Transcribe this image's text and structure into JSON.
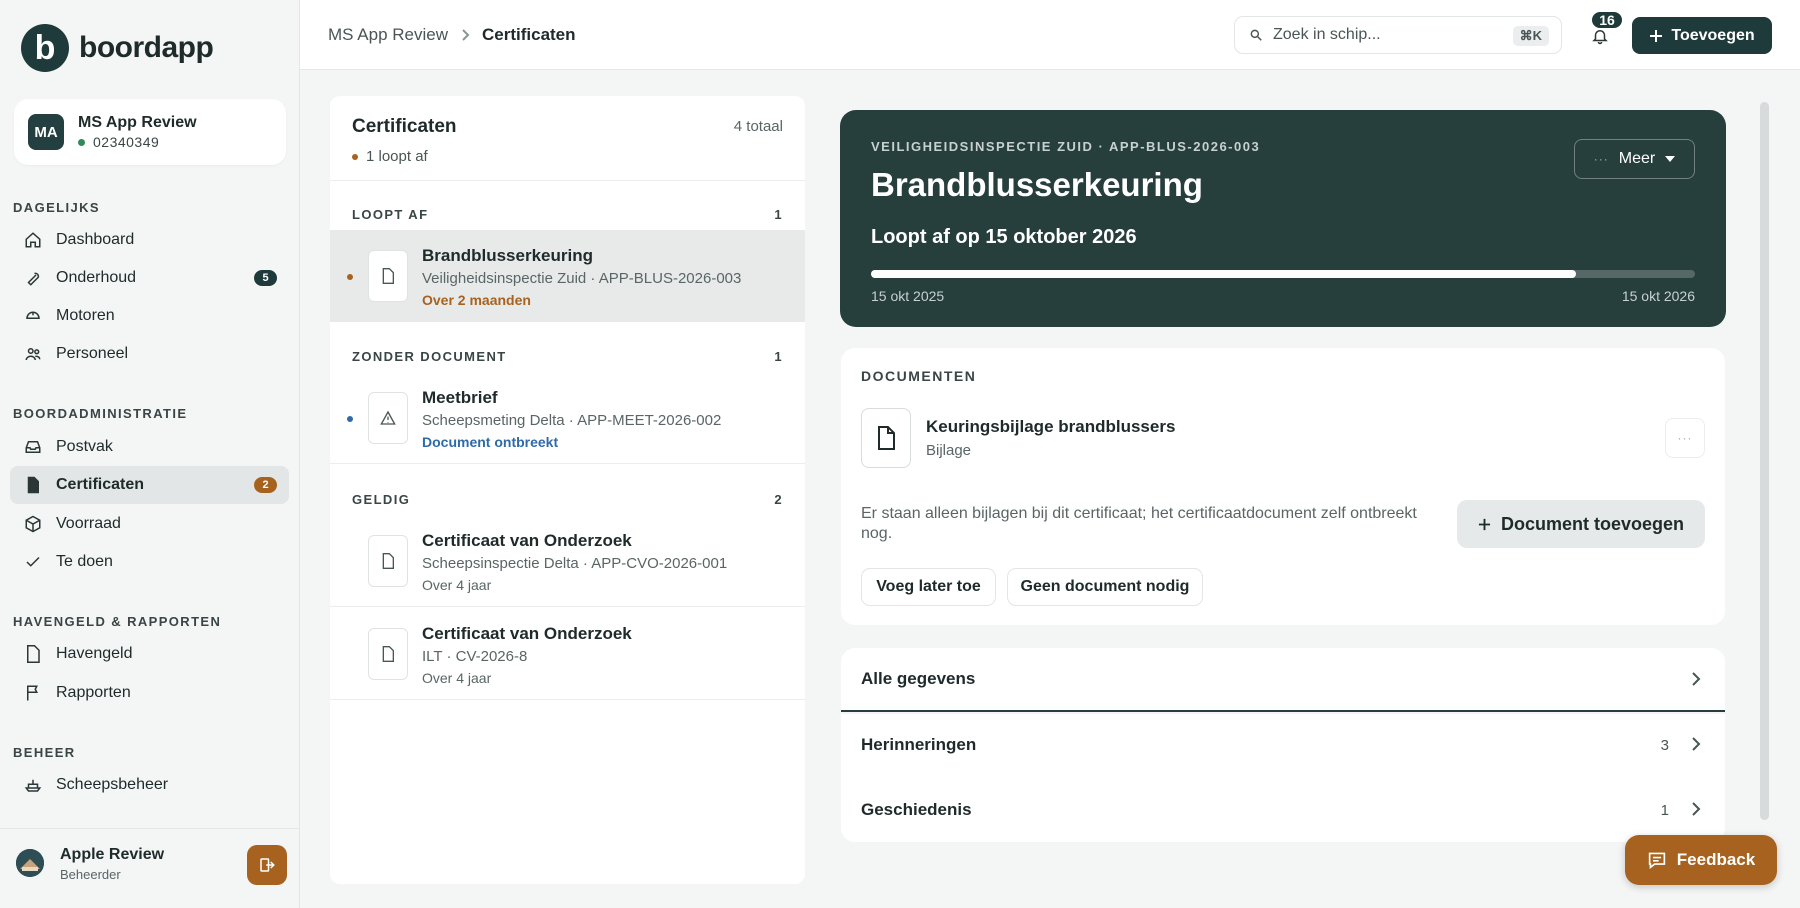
{
  "brand": {
    "logo_letter": "b",
    "name": "boordapp"
  },
  "account": {
    "initials": "MA",
    "name": "MS App Review",
    "id": "02340349"
  },
  "sidebar": {
    "sections": [
      {
        "title": "DAGELIJKS"
      },
      {
        "title": "BOORDADMINISTRATIE"
      },
      {
        "title": "HAVENGELD & RAPPORTEN"
      },
      {
        "title": "BEHEER"
      }
    ],
    "items": [
      {
        "label": "Dashboard",
        "icon": "home-icon"
      },
      {
        "label": "Onderhoud",
        "icon": "wrench-icon",
        "badge": "5"
      },
      {
        "label": "Motoren",
        "icon": "engine-icon"
      },
      {
        "label": "Personeel",
        "icon": "people-icon"
      },
      {
        "label": "Postvak",
        "icon": "inbox-icon"
      },
      {
        "label": "Certificaten",
        "icon": "document-icon",
        "badge": "2",
        "active": true
      },
      {
        "label": "Voorraad",
        "icon": "box-icon"
      },
      {
        "label": "Te doen",
        "icon": "check-icon"
      },
      {
        "label": "Havengeld",
        "icon": "document-icon"
      },
      {
        "label": "Rapporten",
        "icon": "flag-icon"
      },
      {
        "label": "Scheepsbeheer",
        "icon": "ship-icon"
      }
    ],
    "user": {
      "name": "Apple Review",
      "role": "Beheerder"
    }
  },
  "topbar": {
    "breadcrumb": [
      "MS App Review",
      "Certificaten"
    ],
    "search_placeholder": "Zoek in schip...",
    "search_shortcut": "⌘K",
    "notifications": "16",
    "add_label": "Toevoegen"
  },
  "list": {
    "title": "Certificaten",
    "total": "4 totaal",
    "subtitle": "1 loopt af",
    "groups": [
      {
        "title": "LOOPT AF",
        "count": "1"
      },
      {
        "title": "ZONDER DOCUMENT",
        "count": "1"
      },
      {
        "title": "GELDIG",
        "count": "2"
      }
    ],
    "items": [
      {
        "title": "Brandblusserkeuring",
        "subtitle": "Veiligheidsinspectie Zuid · APP-BLUS-2026-003",
        "status": "Over 2 maanden"
      },
      {
        "title": "Meetbrief",
        "subtitle": "Scheepsmeting Delta · APP-MEET-2026-002",
        "status": "Document ontbreekt"
      },
      {
        "title": "Certificaat van Onderzoek",
        "subtitle": "Scheepsinspectie Delta · APP-CVO-2026-001",
        "status": "Over 4 jaar"
      },
      {
        "title": "Certificaat van Onderzoek",
        "subtitle": "ILT · CV-2026-8",
        "status": "Over 4 jaar"
      }
    ]
  },
  "detail": {
    "meta": "VEILIGHEIDSINSPECTIE ZUID · APP-BLUS-2026-003",
    "title": "Brandblusserkeuring",
    "expiry": "Loopt af op 15 oktober 2026",
    "progress": 0.855,
    "start_date": "15 okt 2025",
    "end_date": "15 okt 2026",
    "more_label": "Meer",
    "documents": {
      "heading": "DOCUMENTEN",
      "attachment_title": "Keuringsbijlage brandblussers",
      "attachment_type": "Bijlage",
      "notice": "Er staan alleen bijlagen bij dit certificaat; het certificaatdocument zelf ontbreekt nog.",
      "add_label": "Document toevoegen",
      "later_label": "Voeg later toe",
      "none_label": "Geen document nodig"
    },
    "sections": [
      {
        "label": "Alle gegevens",
        "count": ""
      },
      {
        "label": "Herinneringen",
        "count": "3"
      },
      {
        "label": "Geschiedenis",
        "count": "1"
      }
    ]
  },
  "feedback_label": "Feedback",
  "colors": {
    "primary": "#1f3a3a",
    "hero": "#263e3c",
    "accent": "#a8621f",
    "link": "#2f6ba8"
  }
}
